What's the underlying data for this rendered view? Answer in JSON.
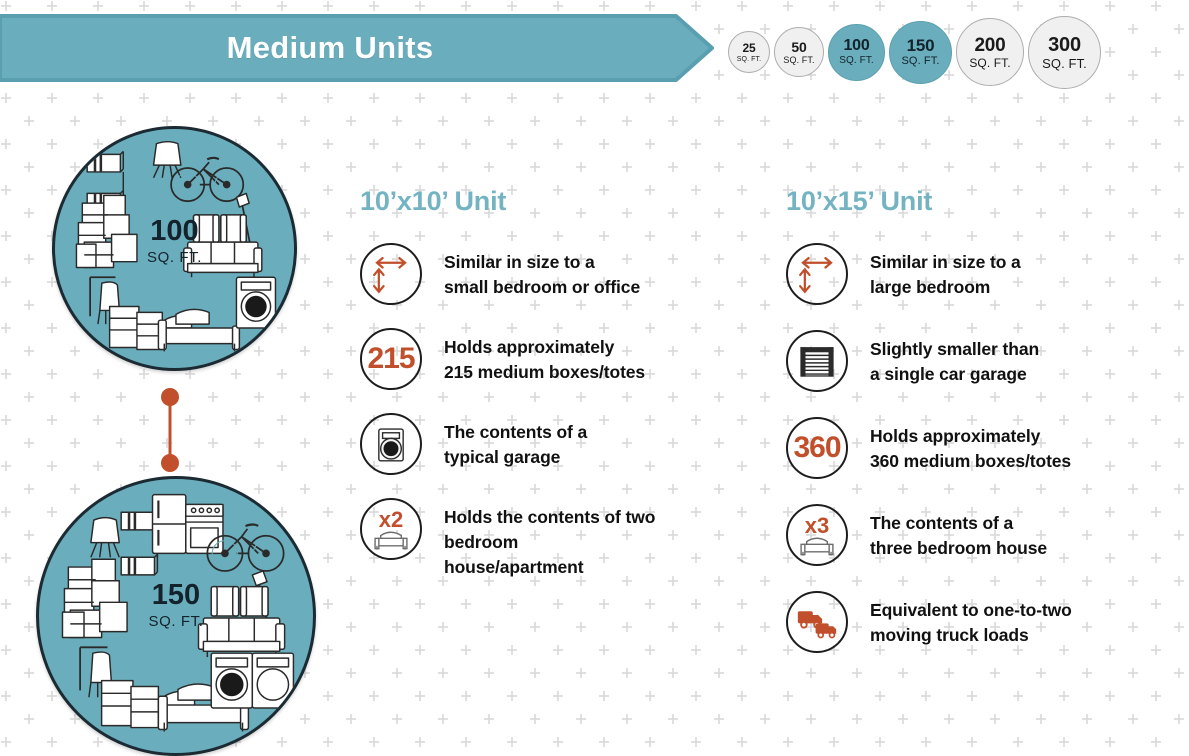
{
  "header": {
    "banner_title": "Medium Units",
    "banner_color": "#6aaebd",
    "banner_border_color": "#5a9fb0"
  },
  "size_selector": {
    "unit_suffix": "SQ. FT.",
    "active_color": "#6aaebd",
    "inactive_color": "#f0f0f0",
    "options": [
      {
        "size": "25",
        "unit": "SQ. FT.",
        "active": false,
        "diameter": 42
      },
      {
        "size": "50",
        "unit": "SQ. FT.",
        "active": false,
        "diameter": 50
      },
      {
        "size": "100",
        "unit": "SQ. FT.",
        "active": true,
        "diameter": 57
      },
      {
        "size": "150",
        "unit": "SQ. FT.",
        "active": true,
        "diameter": 63
      },
      {
        "size": "200",
        "unit": "SQ. FT.",
        "active": false,
        "diameter": 68
      },
      {
        "size": "300",
        "unit": "SQ. FT.",
        "active": false,
        "diameter": 73
      }
    ]
  },
  "unit_visuals": {
    "connector_color": "#c14f2b",
    "circles": [
      {
        "size": "100",
        "unit": "SQ. FT.",
        "fill_color": "#6aaebd",
        "contents": [
          "shelf",
          "chair",
          "bicycle",
          "boxes",
          "floor-lamp",
          "armchair",
          "armchair",
          "sofa",
          "dining-chair",
          "dresser",
          "bed",
          "washing-machine"
        ]
      },
      {
        "size": "150",
        "unit": "SQ. FT.",
        "fill_color": "#6aaebd",
        "contents": [
          "shelf",
          "chair",
          "refrigerator",
          "stove",
          "bicycle",
          "boxes",
          "floor-lamp",
          "armchair",
          "armchair",
          "sofa",
          "dining-chair",
          "dresser",
          "bed",
          "washer",
          "dryer"
        ]
      }
    ]
  },
  "columns": [
    {
      "id": "10x10",
      "heading": "10’x10’ Unit",
      "heading_color": "#74b4c2",
      "features": [
        {
          "icon": "dimensions-arrows-icon",
          "icon_value": "",
          "text": "Similar in size to a\nsmall bedroom or office"
        },
        {
          "icon": "box-count-icon",
          "icon_value": "215",
          "text": "Holds approximately\n215 medium boxes/totes"
        },
        {
          "icon": "washing-machine-icon",
          "icon_value": "",
          "text": "The contents of a\ntypical garage"
        },
        {
          "icon": "bed-multiplier-icon",
          "icon_value": "x2",
          "text": "Holds the contents of two\nbedroom\nhouse/apartment"
        }
      ]
    },
    {
      "id": "10x15",
      "heading": "10’x15’ Unit",
      "heading_color": "#74b4c2",
      "features": [
        {
          "icon": "dimensions-arrows-icon",
          "icon_value": "",
          "text": "Similar in size to a\nlarge bedroom"
        },
        {
          "icon": "garage-door-icon",
          "icon_value": "",
          "text": "Slightly smaller than\na single car garage"
        },
        {
          "icon": "box-count-icon",
          "icon_value": "360",
          "text": "Holds approximately\n360 medium boxes/totes"
        },
        {
          "icon": "bed-multiplier-icon",
          "icon_value": "x3",
          "text": "The contents of a\nthree bedroom house"
        },
        {
          "icon": "moving-trucks-icon",
          "icon_value": "",
          "text": "Equivalent to one-to-two\nmoving truck loads"
        }
      ]
    }
  ]
}
